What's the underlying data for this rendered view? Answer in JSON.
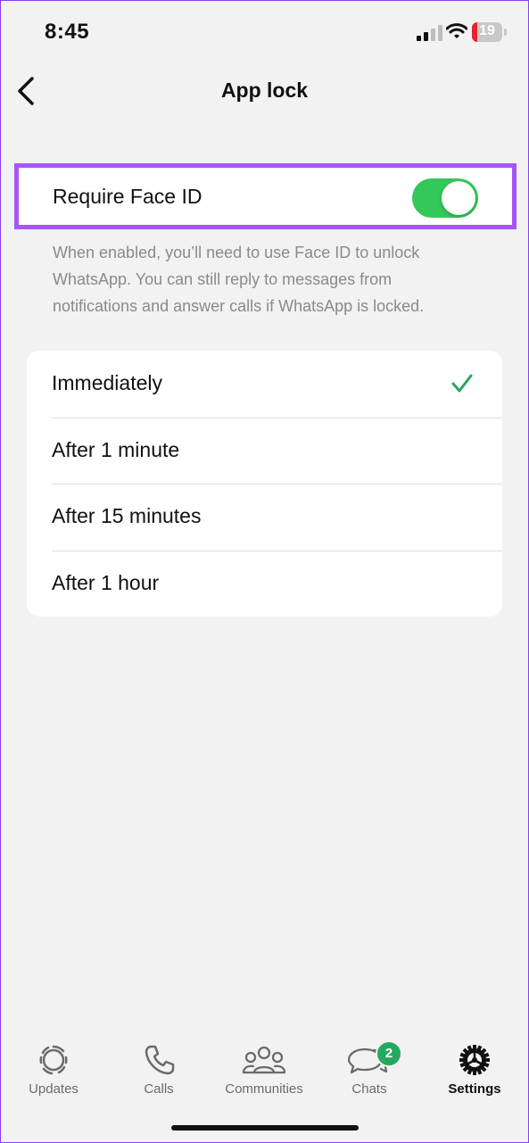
{
  "status_bar": {
    "time": "8:45",
    "battery_level": "19",
    "battery_color": "#e5232c"
  },
  "header": {
    "title": "App lock",
    "back_icon": "chevron-left-icon"
  },
  "face_id": {
    "label": "Require Face ID",
    "enabled": true,
    "toggle_color": "#34c759",
    "highlight_color": "#a855f7",
    "description": "When enabled, you’ll need to use Face ID to unlock WhatsApp. You can still reply to messages from notifications and answer calls if WhatsApp is locked."
  },
  "lock_options": {
    "selected": "Immediately",
    "check_color": "#25a95e",
    "items": [
      {
        "label": "Immediately"
      },
      {
        "label": "After 1 minute"
      },
      {
        "label": "After 15 minutes"
      },
      {
        "label": "After 1 hour"
      }
    ]
  },
  "tab_bar": {
    "active": "Settings",
    "tabs": [
      {
        "label": "Updates",
        "icon": "updates-icon"
      },
      {
        "label": "Calls",
        "icon": "phone-icon"
      },
      {
        "label": "Communities",
        "icon": "communities-icon"
      },
      {
        "label": "Chats",
        "icon": "chat-bubbles-icon",
        "badge": "2"
      },
      {
        "label": "Settings",
        "icon": "gear-icon"
      }
    ]
  }
}
